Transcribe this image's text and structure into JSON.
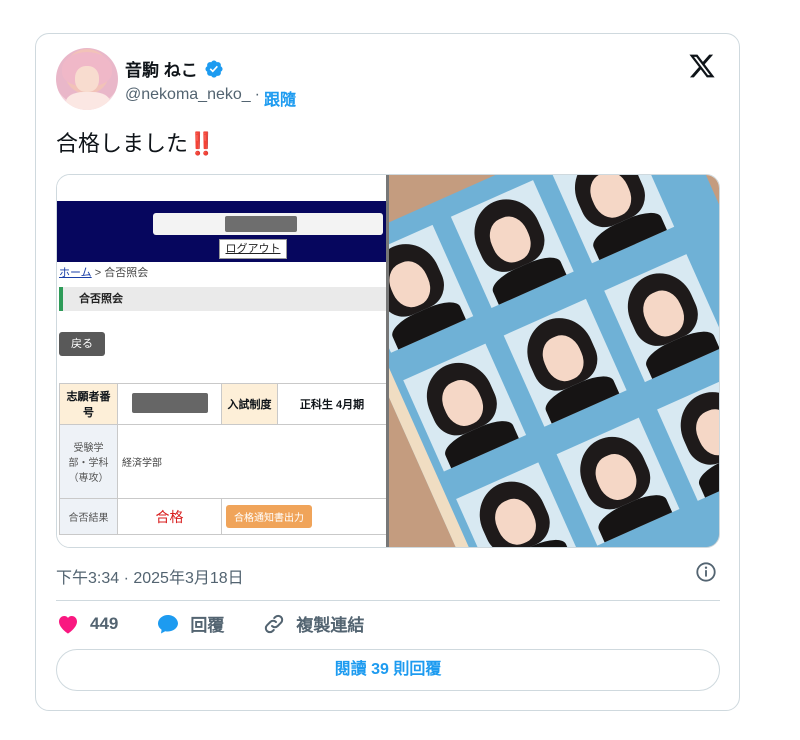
{
  "user": {
    "display_name": "音駒 ねこ",
    "handle": "@nekoma_neko_",
    "separator": "·",
    "follow_label": "跟隨",
    "verified": true
  },
  "tweet": {
    "text": "合格しました",
    "emoji": "‼️"
  },
  "media_left": {
    "logout_label": "ログアウト",
    "breadcrumb_home": "ホーム",
    "breadcrumb_sep": ">",
    "breadcrumb_current": "合否照会",
    "section_title": "合否照会",
    "back_label": "戻る",
    "table": {
      "applicant_no_label": "志願者番号",
      "exam_system_label": "入試制度",
      "exam_system_value": "正科生 4月期",
      "faculty_label": "受験学部・学科（専攻）",
      "faculty_value": "経済学部",
      "result_label": "合否結果",
      "result_value": "合格",
      "notice_button": "合格通知書出力"
    }
  },
  "timestamp": "下午3:34 · 2025年3月18日",
  "actions": {
    "like_count": "449",
    "reply_label": "回覆",
    "copy_link_label": "複製連結"
  },
  "read_replies_label": "閱讀 39 則回覆",
  "colors": {
    "accent": "#1d9bf0",
    "like": "#f91880",
    "text": "#0f1419",
    "muted": "#536471",
    "border": "#cfd9de"
  }
}
